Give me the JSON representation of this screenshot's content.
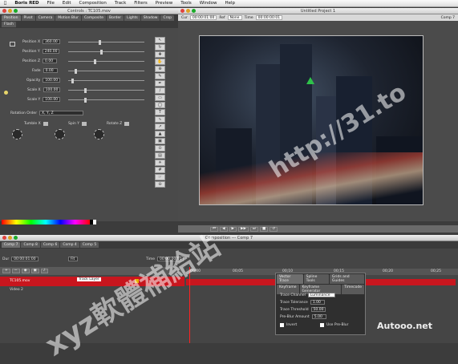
{
  "menubar": {
    "apple": "",
    "app": "Boris RED",
    "items": [
      "File",
      "Edit",
      "Composition",
      "Track",
      "Filters",
      "Preview",
      "Tools",
      "Window",
      "Help"
    ]
  },
  "controls": {
    "title": "Controls : TC105.mov",
    "tabs": [
      "Position",
      "Pivot",
      "Camera",
      "Motion Blur",
      "Composite",
      "Border",
      "Lights",
      "Shadow",
      "Crop",
      "Flash"
    ],
    "params": [
      {
        "label": "Position X",
        "value": "360.00"
      },
      {
        "label": "Position Y",
        "value": "240.00"
      },
      {
        "label": "Position Z",
        "value": "0.00"
      },
      {
        "label": "Fade",
        "value": "0.00"
      },
      {
        "label": "Opacity",
        "value": "100.00"
      },
      {
        "label": "Scale X",
        "value": "100.00"
      },
      {
        "label": "Scale Y",
        "value": "100.00"
      }
    ],
    "rotation_order_label": "Rotation Order",
    "rotation_order": "X, Y, Z",
    "dials": [
      "Tumble X",
      "Spin Y",
      "Rotate Z"
    ]
  },
  "preview": {
    "title": "Untitled Project 1",
    "fields": [
      {
        "label": "Cur",
        "value": "00:00:01:00"
      },
      {
        "label": "Ref",
        "value": "None"
      },
      {
        "label": "Time",
        "value": "00:00:00:01"
      }
    ],
    "right_label": "Comp 7"
  },
  "composition": {
    "title": "Composition --- Comp 7",
    "comp_tabs": [
      "Comp 7",
      "Comp 8",
      "Comp 6",
      "Comp 4",
      "Comp 5"
    ],
    "dur_label": "Dur",
    "dur": "00:00:01:00",
    "fit": "Fit",
    "time_label": "Time",
    "time": "00:00:00:01",
    "tracks": [
      {
        "name": "TC105.mov",
        "tag": "Track Layer",
        "selected": true
      },
      {
        "name": "Video 2",
        "selected": false
      }
    ],
    "ruler": [
      "00;00",
      "00;05",
      "00;10",
      "00;15",
      "00;20",
      "00;25"
    ]
  },
  "popup": {
    "tabs_row1": [
      "Vector Trace",
      "Spline Tools",
      "Grids and Guides"
    ],
    "tabs_row2": [
      "Keyframe",
      "Keyframe Generator",
      "Timecode"
    ],
    "fields": [
      {
        "label": "Trace Channel",
        "value": "Luminance"
      },
      {
        "label": "Trace Tolerance",
        "value": "1.00"
      },
      {
        "label": "Trace Threshold",
        "value": "50.00"
      },
      {
        "label": "Pre-Blur Amount",
        "value": "5.00"
      }
    ],
    "check_invert": "Invert",
    "check_preblur": "Use Pre-Blur"
  },
  "watermark": {
    "url": "http://31.to",
    "site": "xyz軟體補給站",
    "logo": "Autooo.net"
  },
  "colors": {
    "accent": "#c8161e",
    "bg": "#3c3c3c"
  }
}
